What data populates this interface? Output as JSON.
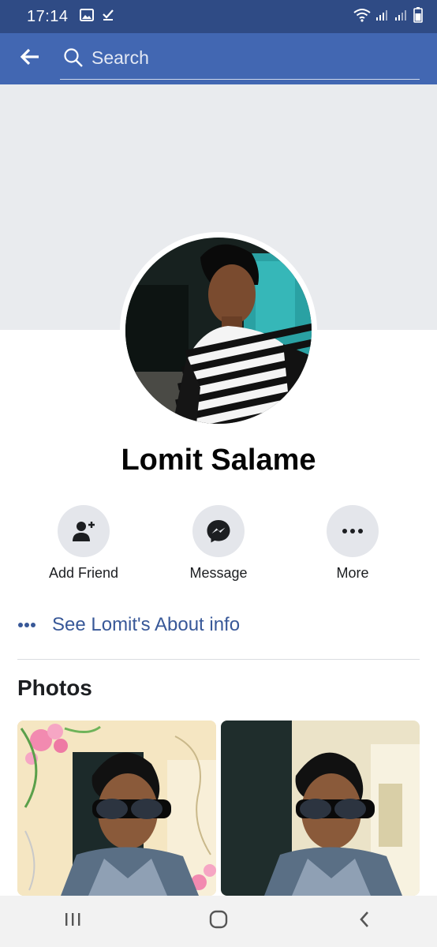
{
  "status_bar": {
    "time": "17:14",
    "icons": [
      "gallery-icon",
      "check-icon",
      "wifi-icon",
      "signal-icon",
      "signal-icon",
      "battery-icon"
    ]
  },
  "header": {
    "back_icon": "arrow-left-icon",
    "search_placeholder": "Search",
    "search_value": "",
    "bg_color": "#4267b2"
  },
  "profile": {
    "name": "Lomit Salame"
  },
  "actions": [
    {
      "label": "Add Friend",
      "icon": "add-friend-icon"
    },
    {
      "label": "Message",
      "icon": "messenger-icon"
    },
    {
      "label": "More",
      "icon": "more-icon"
    }
  ],
  "about": {
    "label": "See Lomit's About info",
    "icon": "more-dots-icon"
  },
  "photos": {
    "title": "Photos"
  },
  "nav": {
    "buttons": [
      "recent-apps-icon",
      "home-icon",
      "back-icon"
    ]
  },
  "colors": {
    "accent": "#385898",
    "status_bar": "#2f4b85",
    "cover": "#e9ebee"
  }
}
